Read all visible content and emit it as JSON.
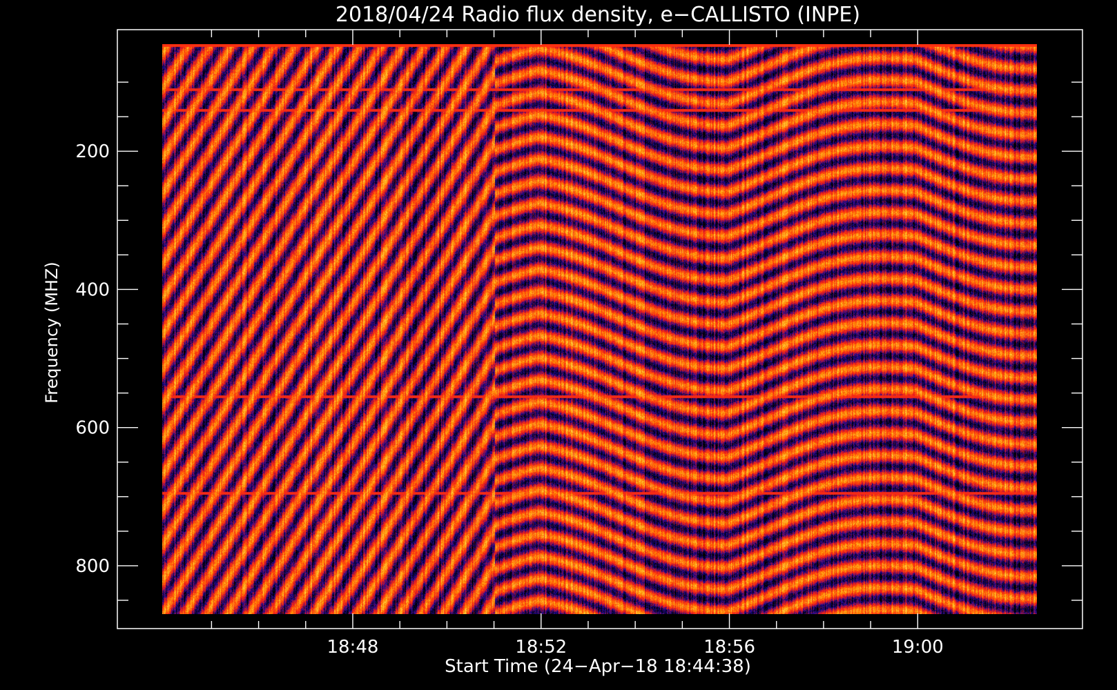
{
  "chart_data": {
    "type": "heatmap",
    "title": "2018/04/24  Radio flux density, e−CALLISTO (INPE)",
    "xlabel": "Start Time (24−Apr−18 18:44:38)",
    "ylabel": "Frequency (MHZ)",
    "x_range_minutes": [
      "18:44:38",
      "19:00:00"
    ],
    "xlim": [
      "18:43:00",
      "19:03:30"
    ],
    "ylim": [
      45,
      870
    ],
    "y_inverted": true,
    "x_ticks": [
      {
        "label": "18:48"
      },
      {
        "label": "18:52"
      },
      {
        "label": "18:56"
      },
      {
        "label": "19:00"
      }
    ],
    "y_ticks": [
      {
        "label": "200"
      },
      {
        "label": "400"
      },
      {
        "label": "600"
      },
      {
        "label": "800"
      }
    ],
    "x_tick_values_min": [
      0,
      0,
      0,
      0
    ],
    "y_tick_values": [
      200,
      400,
      600,
      800
    ],
    "frequency_range_mhz": [
      45,
      870
    ],
    "colors": {
      "background": "#000000",
      "axes": "#ffffff",
      "colormap": [
        "#000000",
        "#1a0a9a",
        "#d2142a",
        "#ff3010",
        "#ff8a00",
        "#ffd040"
      ]
    },
    "notable_rfi_bands_mhz": [
      110,
      140,
      555,
      695
    ]
  }
}
